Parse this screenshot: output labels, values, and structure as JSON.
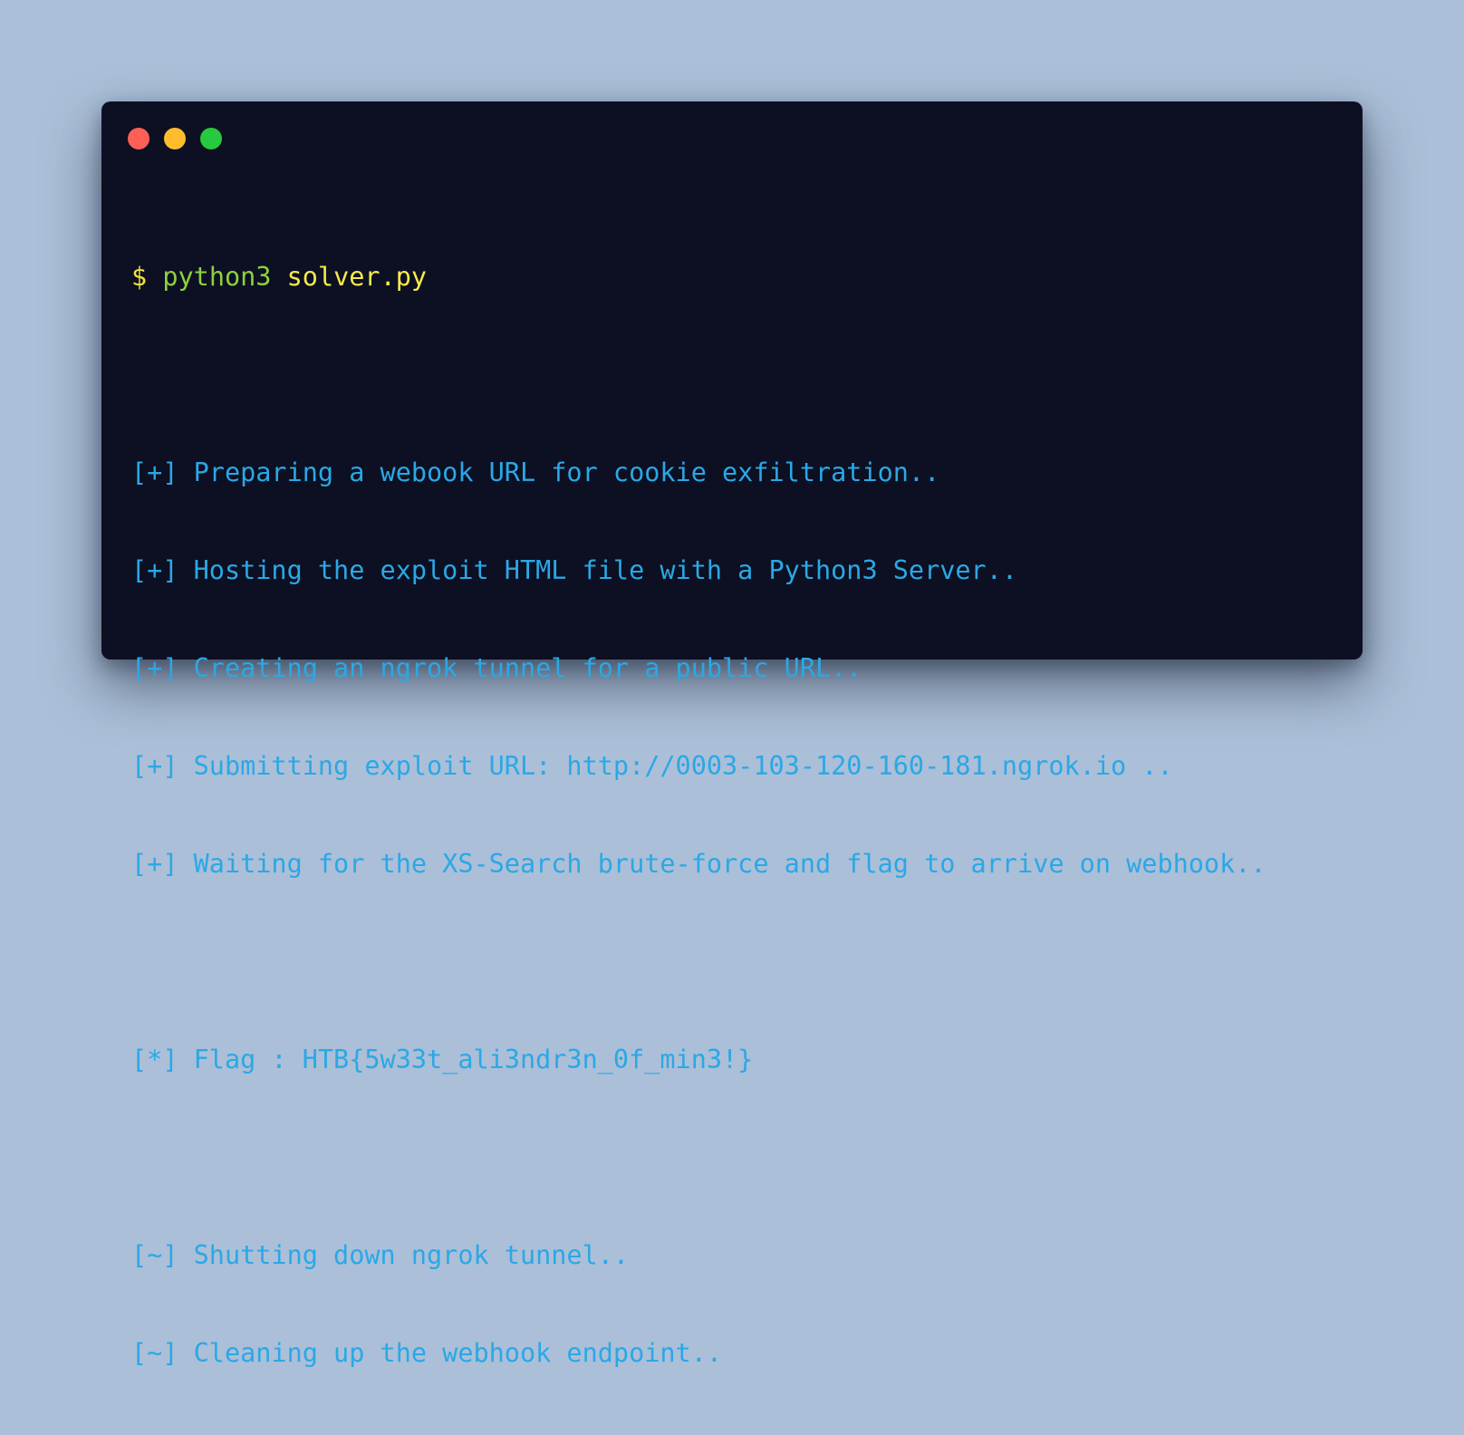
{
  "terminal": {
    "window_controls": {
      "close_color": "#ff5f57",
      "minimize_color": "#febc2e",
      "maximize_color": "#28c840"
    },
    "command": {
      "prompt": "$",
      "program": "python3",
      "argument": "solver.py"
    },
    "output_block_1": [
      "[+] Preparing a webook URL for cookie exfiltration..",
      "[+] Hosting the exploit HTML file with a Python3 Server..",
      "[+] Creating an ngrok tunnel for a public URL..",
      "[+] Submitting exploit URL: http://0003-103-120-160-181.ngrok.io ..",
      "[+] Waiting for the XS-Search brute-force and flag to arrive on webhook.."
    ],
    "flag_line": "[*] Flag : HTB{5w33t_ali3ndr3n_0f_min3!}",
    "output_block_2": [
      "[~] Shutting down ngrok tunnel..",
      "[~] Cleaning up the webhook endpoint.."
    ],
    "colors": {
      "background": "#0c1022",
      "prompt": "#f2e23a",
      "program": "#8fd13a",
      "argument": "#f7ea4a",
      "output": "#2aa8e6"
    }
  }
}
